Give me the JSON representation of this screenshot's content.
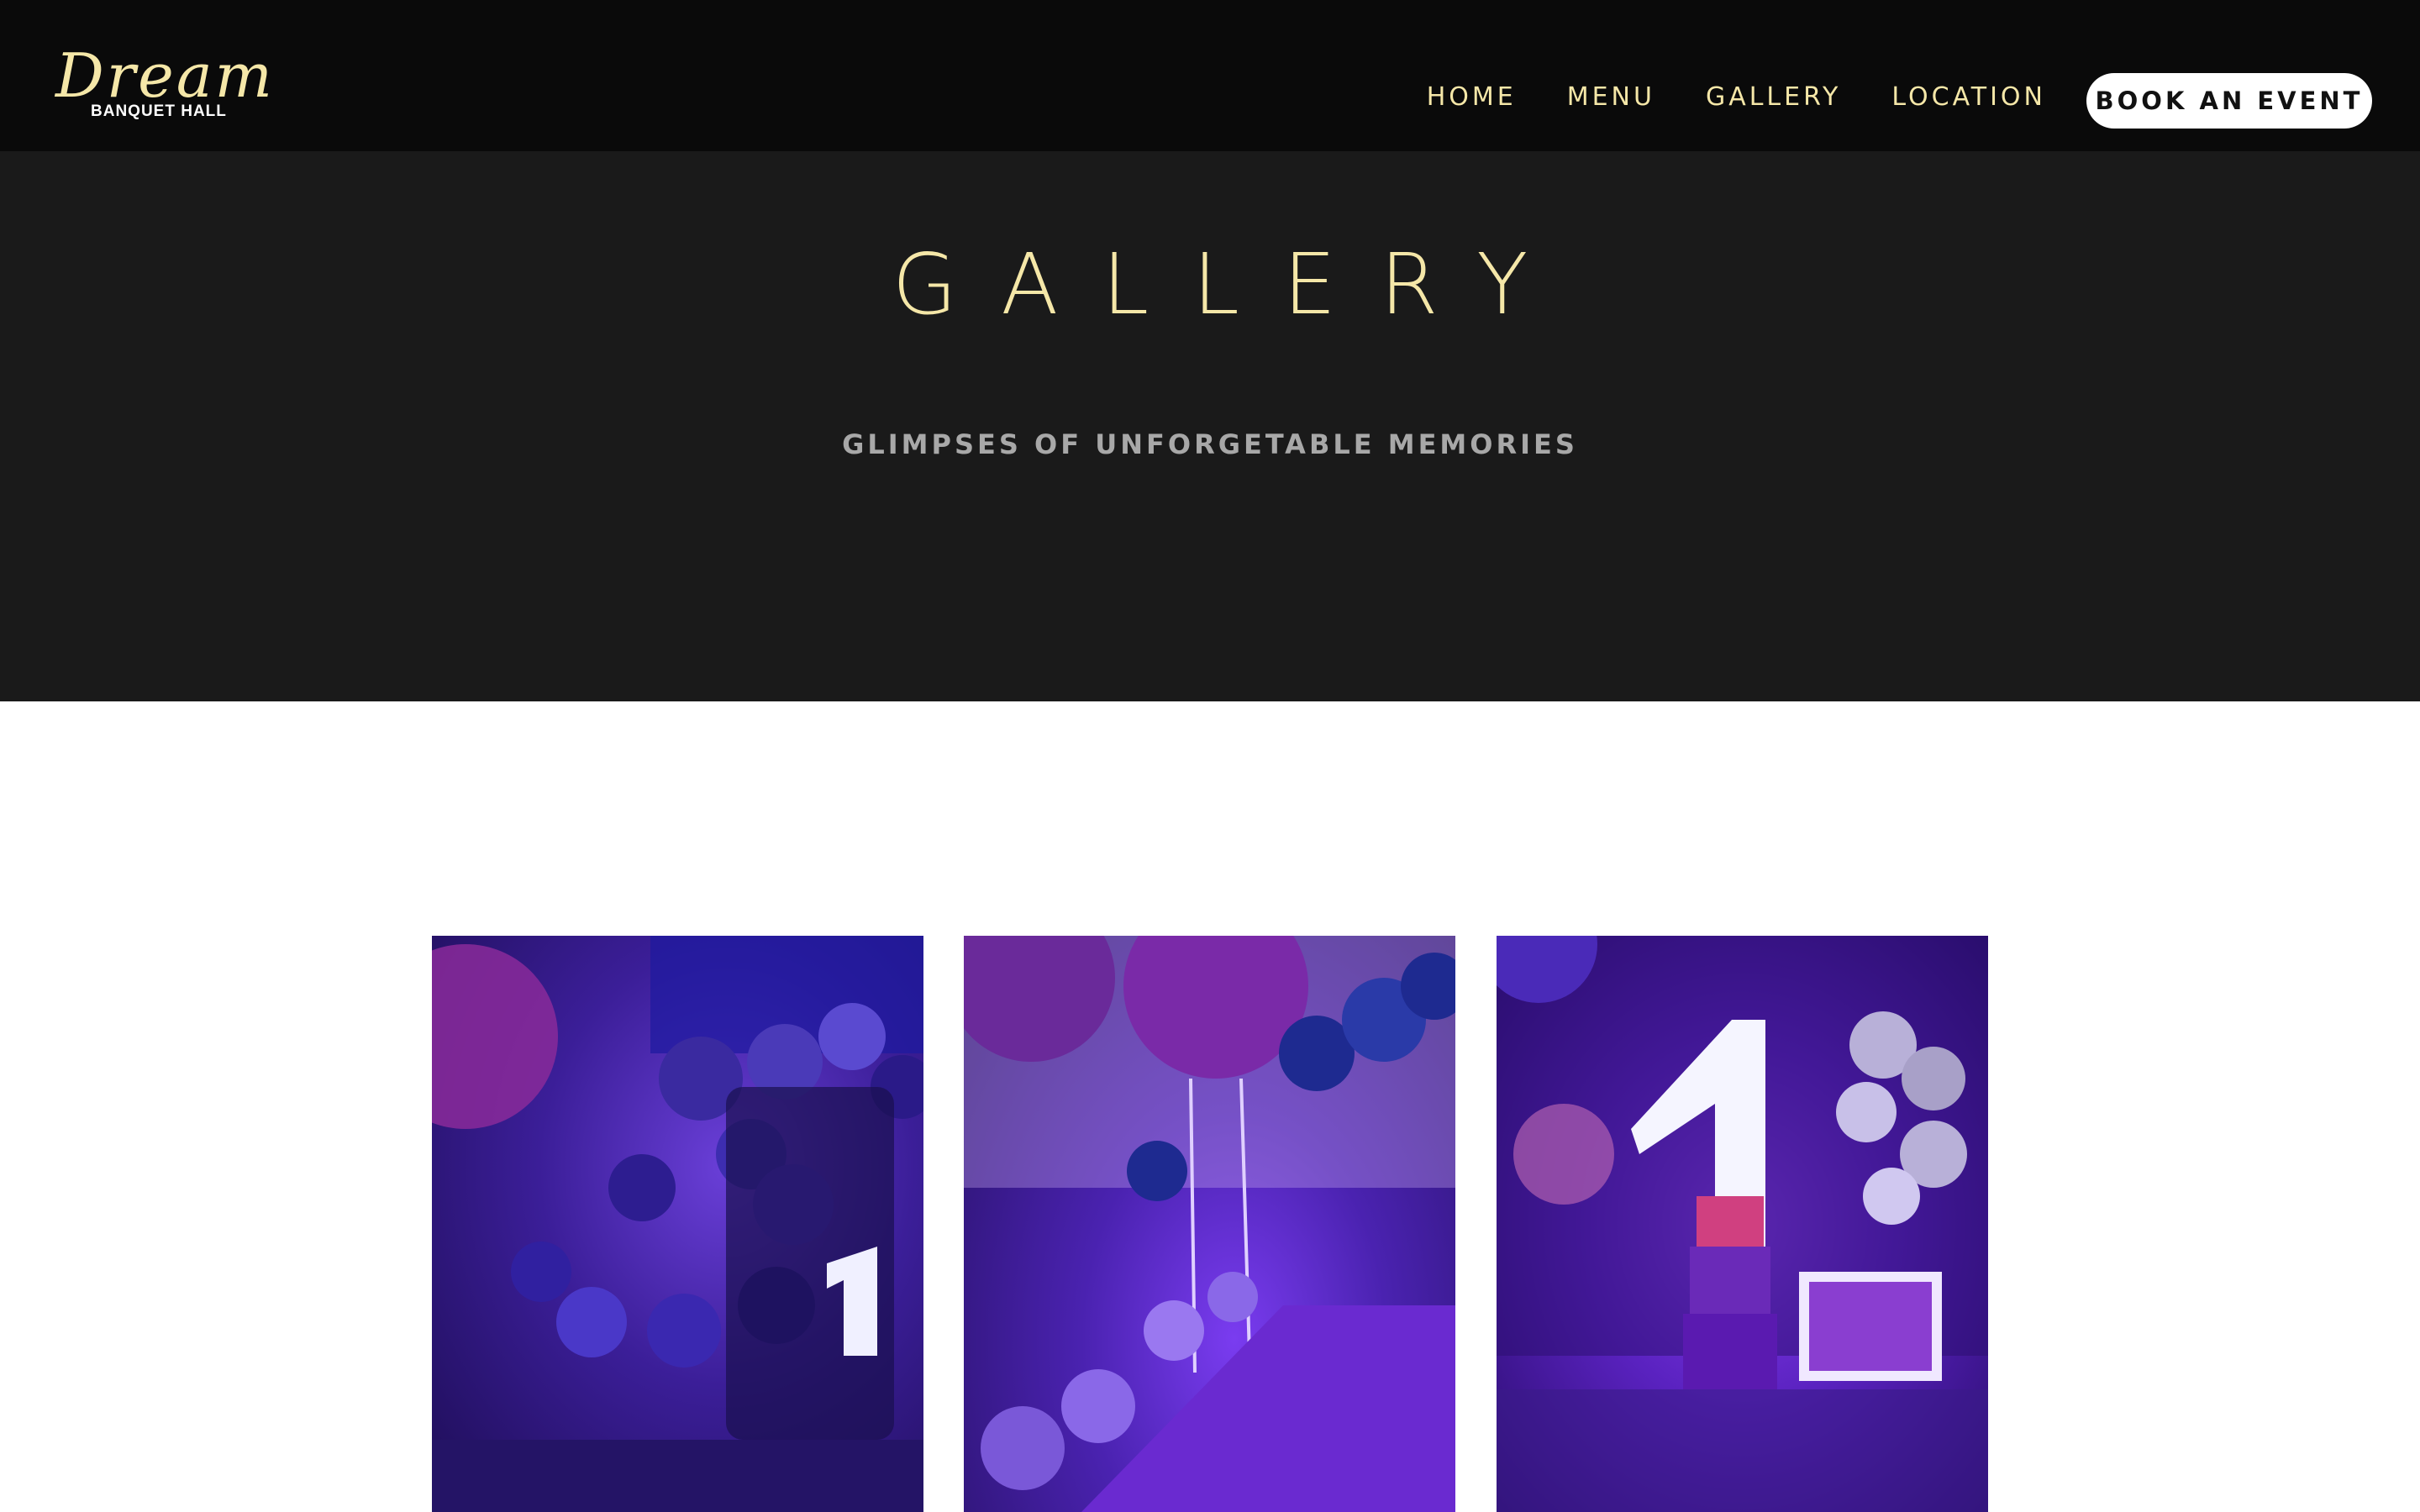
{
  "brand": {
    "name": "Dream",
    "tagline": "BANQUET HALL",
    "color": "#f5e7a8"
  },
  "nav": {
    "items": [
      {
        "label": "HOME"
      },
      {
        "label": "MENU"
      },
      {
        "label": "GALLERY"
      },
      {
        "label": "LOCATION"
      }
    ],
    "cta_label": "BOOK AN EVENT"
  },
  "hero": {
    "title": "GALLERY",
    "subtitle": "GLIMPSES OF UNFORGETABLE MEMORIES"
  },
  "gallery": {
    "items": [
      {
        "theme": "purple balloon decor with number one"
      },
      {
        "theme": "banquet table with purple balloons"
      },
      {
        "theme": "birthday cake table with number one"
      }
    ]
  },
  "colors": {
    "nav_bg": "#0a0a0a",
    "hero_bg": "#1a1a1a",
    "accent": "#f5e7a8",
    "subtitle": "#a8a8a8"
  }
}
